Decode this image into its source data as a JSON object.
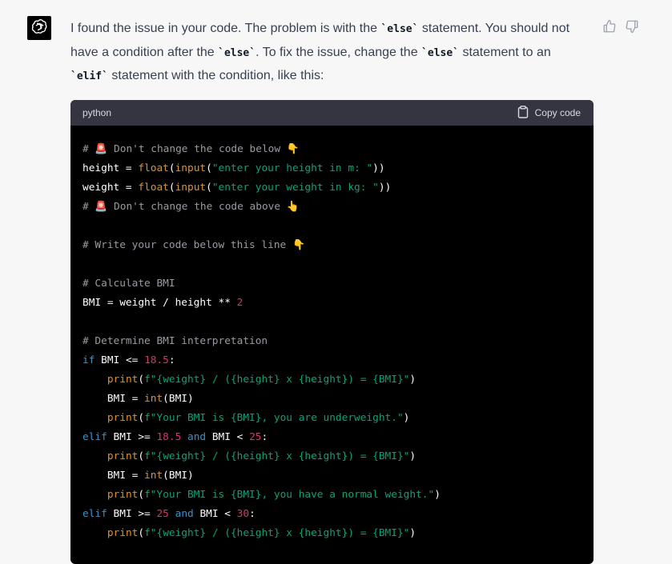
{
  "message": {
    "segments": [
      {
        "type": "text",
        "value": "I found the issue in your code. The problem is with the "
      },
      {
        "type": "code",
        "value": "`else`"
      },
      {
        "type": "text",
        "value": " statement. You should not have a condition after the "
      },
      {
        "type": "code",
        "value": "`else`"
      },
      {
        "type": "text",
        "value": ". To fix the issue, change the "
      },
      {
        "type": "code",
        "value": "`else`"
      },
      {
        "type": "text",
        "value": " statement to an "
      },
      {
        "type": "code",
        "value": "`elif`"
      },
      {
        "type": "text",
        "value": " statement with the condition, like this:"
      }
    ]
  },
  "feedback": {
    "thumbs_up_icon": "thumbs-up",
    "thumbs_down_icon": "thumbs-down"
  },
  "code_block": {
    "language": "python",
    "copy_label": "Copy code",
    "lines": [
      [
        {
          "t": "comment",
          "v": "# 🚨 Don't change the code below 👇"
        }
      ],
      [
        {
          "t": "plain",
          "v": "height = "
        },
        {
          "t": "func",
          "v": "float"
        },
        {
          "t": "plain",
          "v": "("
        },
        {
          "t": "func",
          "v": "input"
        },
        {
          "t": "plain",
          "v": "("
        },
        {
          "t": "str",
          "v": "\"enter your height in m: \""
        },
        {
          "t": "plain",
          "v": "))"
        }
      ],
      [
        {
          "t": "plain",
          "v": "weight = "
        },
        {
          "t": "func",
          "v": "float"
        },
        {
          "t": "plain",
          "v": "("
        },
        {
          "t": "func",
          "v": "input"
        },
        {
          "t": "plain",
          "v": "("
        },
        {
          "t": "str",
          "v": "\"enter your weight in kg: \""
        },
        {
          "t": "plain",
          "v": "))"
        }
      ],
      [
        {
          "t": "comment",
          "v": "# 🚨 Don't change the code above 👆"
        }
      ],
      [],
      [
        {
          "t": "comment",
          "v": "# Write your code below this line 👇"
        }
      ],
      [],
      [
        {
          "t": "comment",
          "v": "# Calculate BMI"
        }
      ],
      [
        {
          "t": "plain",
          "v": "BMI = weight / height ** "
        },
        {
          "t": "num",
          "v": "2"
        }
      ],
      [],
      [
        {
          "t": "comment",
          "v": "# Determine BMI interpretation"
        }
      ],
      [
        {
          "t": "kw",
          "v": "if"
        },
        {
          "t": "plain",
          "v": " BMI <= "
        },
        {
          "t": "num",
          "v": "18.5"
        },
        {
          "t": "plain",
          "v": ":"
        }
      ],
      [
        {
          "t": "plain",
          "v": "    "
        },
        {
          "t": "func",
          "v": "print"
        },
        {
          "t": "plain",
          "v": "("
        },
        {
          "t": "str",
          "v": "f\"{weight} / ({height} x {height}) = {BMI}\""
        },
        {
          "t": "plain",
          "v": ")"
        }
      ],
      [
        {
          "t": "plain",
          "v": "    BMI = "
        },
        {
          "t": "func",
          "v": "int"
        },
        {
          "t": "plain",
          "v": "(BMI)"
        }
      ],
      [
        {
          "t": "plain",
          "v": "    "
        },
        {
          "t": "func",
          "v": "print"
        },
        {
          "t": "plain",
          "v": "("
        },
        {
          "t": "str",
          "v": "f\"Your BMI is {BMI}, you are underweight.\""
        },
        {
          "t": "plain",
          "v": ")"
        }
      ],
      [
        {
          "t": "kw",
          "v": "elif"
        },
        {
          "t": "plain",
          "v": " BMI >= "
        },
        {
          "t": "num",
          "v": "18.5"
        },
        {
          "t": "plain",
          "v": " "
        },
        {
          "t": "kw",
          "v": "and"
        },
        {
          "t": "plain",
          "v": " BMI < "
        },
        {
          "t": "num",
          "v": "25"
        },
        {
          "t": "plain",
          "v": ":"
        }
      ],
      [
        {
          "t": "plain",
          "v": "    "
        },
        {
          "t": "func",
          "v": "print"
        },
        {
          "t": "plain",
          "v": "("
        },
        {
          "t": "str",
          "v": "f\"{weight} / ({height} x {height}) = {BMI}\""
        },
        {
          "t": "plain",
          "v": ")"
        }
      ],
      [
        {
          "t": "plain",
          "v": "    BMI = "
        },
        {
          "t": "func",
          "v": "int"
        },
        {
          "t": "plain",
          "v": "(BMI)"
        }
      ],
      [
        {
          "t": "plain",
          "v": "    "
        },
        {
          "t": "func",
          "v": "print"
        },
        {
          "t": "plain",
          "v": "("
        },
        {
          "t": "str",
          "v": "f\"Your BMI is {BMI}, you have a normal weight.\""
        },
        {
          "t": "plain",
          "v": ")"
        }
      ],
      [
        {
          "t": "kw",
          "v": "elif"
        },
        {
          "t": "plain",
          "v": " BMI >= "
        },
        {
          "t": "num",
          "v": "25"
        },
        {
          "t": "plain",
          "v": " "
        },
        {
          "t": "kw",
          "v": "and"
        },
        {
          "t": "plain",
          "v": " BMI < "
        },
        {
          "t": "num",
          "v": "30"
        },
        {
          "t": "plain",
          "v": ":"
        }
      ],
      [
        {
          "t": "plain",
          "v": "    "
        },
        {
          "t": "func",
          "v": "print"
        },
        {
          "t": "plain",
          "v": "("
        },
        {
          "t": "str",
          "v": "f\"{weight} / ({height} x {height}) = {BMI}\""
        },
        {
          "t": "plain",
          "v": ")"
        }
      ]
    ]
  },
  "colors": {
    "page_bg": "#f7f7f8",
    "code_bg": "#000000",
    "code_header_bg": "#343541",
    "comment": "#9a9aa5",
    "function": "#e9950c",
    "string": "#00a67d",
    "number": "#df3079",
    "keyword": "#2e95d3"
  }
}
